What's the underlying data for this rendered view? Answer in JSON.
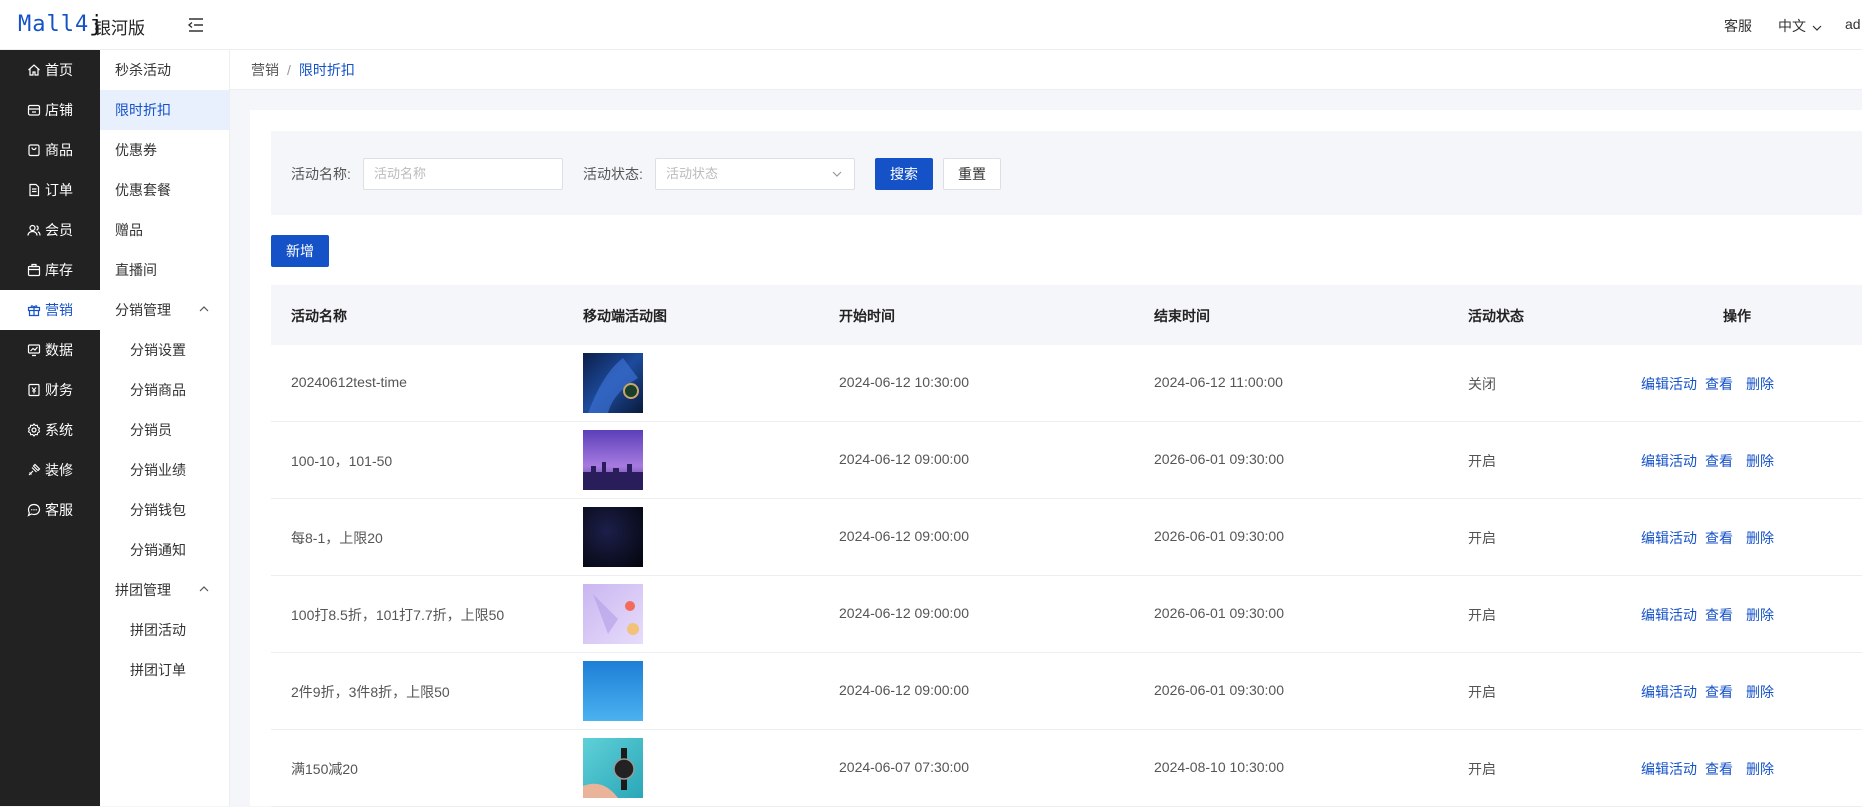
{
  "header": {
    "logo_main": "Mall4",
    "logo_j": "j",
    "edition": "银河版",
    "service": "客服",
    "language": "中文",
    "user": "ad"
  },
  "sidebar": {
    "items": [
      {
        "label": "首页",
        "icon": "home-icon"
      },
      {
        "label": "店铺",
        "icon": "shop-icon"
      },
      {
        "label": "商品",
        "icon": "bag-icon"
      },
      {
        "label": "订单",
        "icon": "order-icon"
      },
      {
        "label": "会员",
        "icon": "members-icon"
      },
      {
        "label": "库存",
        "icon": "box-icon"
      },
      {
        "label": "营销",
        "icon": "gift-icon"
      },
      {
        "label": "数据",
        "icon": "chart-icon"
      },
      {
        "label": "财务",
        "icon": "finance-icon"
      },
      {
        "label": "系统",
        "icon": "gear-icon"
      },
      {
        "label": "装修",
        "icon": "brush-icon"
      },
      {
        "label": "客服",
        "icon": "chat-icon"
      }
    ]
  },
  "submenu": {
    "items": [
      {
        "label": "秒杀活动"
      },
      {
        "label": "限时折扣"
      },
      {
        "label": "优惠券"
      },
      {
        "label": "优惠套餐"
      },
      {
        "label": "赠品"
      },
      {
        "label": "直播间"
      },
      {
        "label": "分销管理"
      },
      {
        "label": "分销设置"
      },
      {
        "label": "分销商品"
      },
      {
        "label": "分销员"
      },
      {
        "label": "分销业绩"
      },
      {
        "label": "分销钱包"
      },
      {
        "label": "分销通知"
      },
      {
        "label": "拼团管理"
      },
      {
        "label": "拼团活动"
      },
      {
        "label": "拼团订单"
      }
    ]
  },
  "breadcrumb": {
    "parent": "营销",
    "separator": "/",
    "current": "限时折扣"
  },
  "search": {
    "name_label": "活动名称:",
    "name_placeholder": "活动名称",
    "status_label": "活动状态:",
    "status_placeholder": "活动状态",
    "search_button": "搜索",
    "reset_button": "重置"
  },
  "add_button": "新增",
  "table": {
    "headers": [
      "活动名称",
      "移动端活动图",
      "开始时间",
      "结束时间",
      "活动状态",
      "操作"
    ],
    "actions": {
      "edit": "编辑活动",
      "view": "查看",
      "delete": "删除"
    },
    "rows": [
      {
        "name": "20240612test-time",
        "start": "2024-06-12 10:30:00",
        "end": "2024-06-12 11:00:00",
        "status": "关闭"
      },
      {
        "name": "100-10，101-50",
        "start": "2024-06-12 09:00:00",
        "end": "2026-06-01 09:30:00",
        "status": "开启"
      },
      {
        "name": "每8-1，上限20",
        "start": "2024-06-12 09:00:00",
        "end": "2026-06-01 09:30:00",
        "status": "开启"
      },
      {
        "name": "100打8.5折，101打7.7折，上限50",
        "start": "2024-06-12 09:00:00",
        "end": "2026-06-01 09:30:00",
        "status": "开启"
      },
      {
        "name": "2件9折，3件8折，上限50",
        "start": "2024-06-12 09:00:00",
        "end": "2026-06-01 09:30:00",
        "status": "开启"
      },
      {
        "name": "满150减20",
        "start": "2024-06-07 07:30:00",
        "end": "2024-08-10 10:30:00",
        "status": "开启"
      }
    ]
  },
  "colors": {
    "primary": "#1552c8",
    "sidebar_bg": "#222222",
    "active_bg": "#e8effd"
  }
}
